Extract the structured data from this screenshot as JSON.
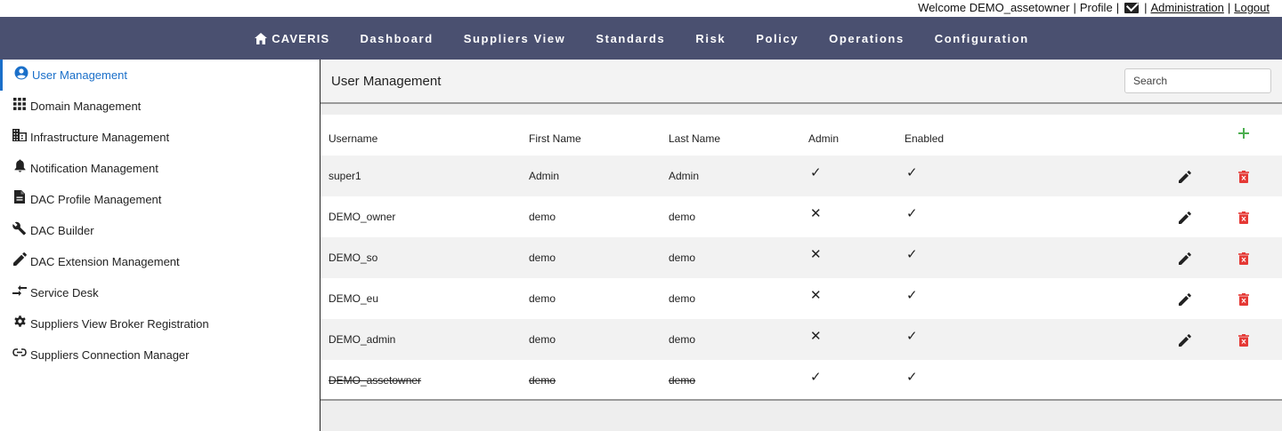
{
  "topbar": {
    "welcome": "Welcome DEMO_assetowner",
    "sep1": "|",
    "profile": "Profile",
    "sep2": "|",
    "sep3": "|",
    "administration": "Administration",
    "sep4": "|",
    "logout": "Logout"
  },
  "nav": {
    "brand": "CAVERIS",
    "items": [
      "Dashboard",
      "Suppliers View",
      "Standards",
      "Risk",
      "Policy",
      "Operations",
      "Configuration"
    ],
    "color": "#4a5070"
  },
  "sidebar": {
    "active_color": "#1a6fc9",
    "items": [
      {
        "label": "User Management",
        "icon": "account-circle-icon"
      },
      {
        "label": "Domain Management",
        "icon": "grid-icon"
      },
      {
        "label": "Infrastructure Management",
        "icon": "building-icon"
      },
      {
        "label": "Notification Management",
        "icon": "bell-icon"
      },
      {
        "label": "DAC Profile Management",
        "icon": "document-icon"
      },
      {
        "label": "DAC Builder",
        "icon": "wrench-icon"
      },
      {
        "label": "DAC Extension Management",
        "icon": "pencil-icon"
      },
      {
        "label": "Service Desk",
        "icon": "swap-arrows-icon"
      },
      {
        "label": "Suppliers View Broker Registration",
        "icon": "gear-icon"
      },
      {
        "label": "Suppliers Connection Manager",
        "icon": "link-icon"
      }
    ]
  },
  "main": {
    "title": "User Management",
    "search_placeholder": "Search"
  },
  "table": {
    "columns": [
      "Username",
      "First Name",
      "Last Name",
      "Admin",
      "Enabled"
    ],
    "rows": [
      {
        "username": "super1",
        "first": "Admin",
        "last": "Admin",
        "admin": "✓",
        "enabled": "✓",
        "actions": true,
        "disabled": false
      },
      {
        "username": "DEMO_owner",
        "first": "demo",
        "last": "demo",
        "admin": "✕",
        "enabled": "✓",
        "actions": true,
        "disabled": false
      },
      {
        "username": "DEMO_so",
        "first": "demo",
        "last": "demo",
        "admin": "✕",
        "enabled": "✓",
        "actions": true,
        "disabled": false
      },
      {
        "username": "DEMO_eu",
        "first": "demo",
        "last": "demo",
        "admin": "✕",
        "enabled": "✓",
        "actions": true,
        "disabled": false
      },
      {
        "username": "DEMO_admin",
        "first": "demo",
        "last": "demo",
        "admin": "✕",
        "enabled": "✓",
        "actions": true,
        "disabled": false
      },
      {
        "username": "DEMO_assetowner",
        "first": "demo",
        "last": "demo",
        "admin": "✓",
        "enabled": "✓",
        "actions": false,
        "disabled": true
      }
    ],
    "add_color": "#4caf50",
    "delete_color": "#e53935"
  }
}
